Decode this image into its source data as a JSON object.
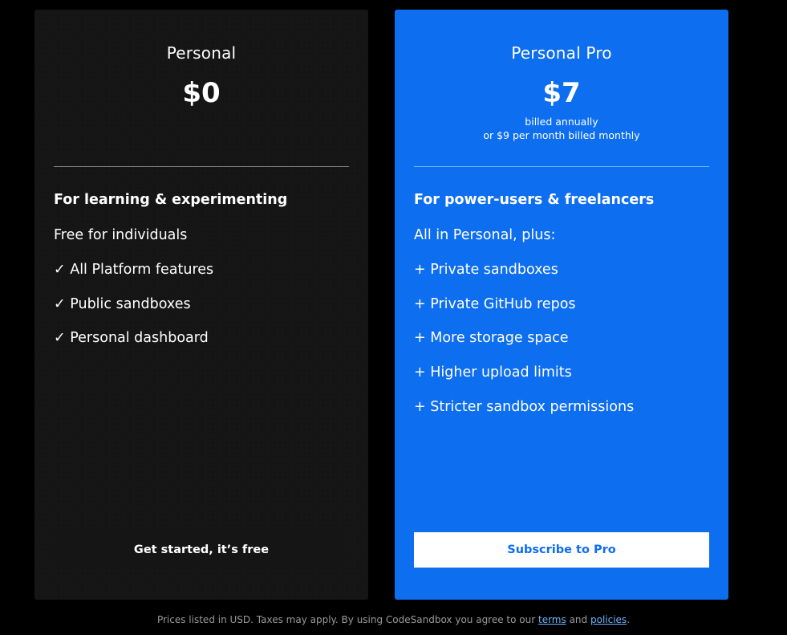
{
  "colors": {
    "page_background": "#000000",
    "personal_card": "#151515",
    "pro_card": "#0d6ef0",
    "pro_button_text": "#0d6ef0",
    "link": "#6cb3ff",
    "footer_text": "#9a9a9a"
  },
  "plans": [
    {
      "name": "Personal",
      "price": "$0",
      "billing_line1": "",
      "billing_line2": "",
      "tagline": "For learning & experimenting",
      "features": [
        "Free for individuals",
        "✓ All Platform features",
        "✓ Public sandboxes",
        "✓ Personal dashboard"
      ],
      "cta_label": "Get started, it’s free"
    },
    {
      "name": "Personal Pro",
      "price": "$7",
      "billing_line1": "billed annually",
      "billing_line2": "or $9 per month billed monthly",
      "tagline": "For power-users & freelancers",
      "features": [
        "All in Personal, plus:",
        "+ Private sandboxes",
        "+ Private GitHub repos",
        "+ More storage space",
        "+ Higher upload limits",
        "+ Stricter sandbox permissions"
      ],
      "cta_label": "Subscribe to Pro"
    }
  ],
  "footer": {
    "text_before": "Prices listed in USD. Taxes may apply. By using CodeSandbox you agree to our ",
    "terms_link": "terms",
    "text_middle": " and ",
    "policies_link": "policies",
    "text_after": "."
  }
}
